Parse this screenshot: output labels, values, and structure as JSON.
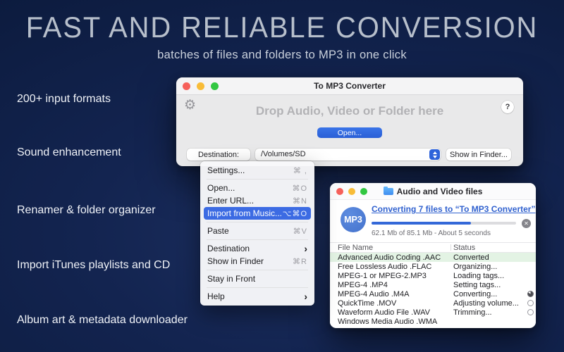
{
  "page": {
    "title": "FAST AND RELIABLE CONVERSION",
    "subtitle": "batches of files and folders to MP3 in one click"
  },
  "features": [
    {
      "label": "200+ input formats"
    },
    {
      "label": "Sound enhancement"
    },
    {
      "label": "Renamer & folder organizer"
    },
    {
      "label": "Import iTunes playlists and CD"
    },
    {
      "label": "Album art & metadata downloader"
    }
  ],
  "main_window": {
    "title": "To MP3 Converter",
    "drop_hint": "Drop Audio, Video or Folder here",
    "open_button": "Open...",
    "destination_button": "Destination:",
    "destination_path": "/Volumes/SD",
    "show_in_finder_button": "Show in Finder...",
    "help_button": "?",
    "gear_icon": "⚙"
  },
  "menu": {
    "items": [
      {
        "label": "Settings...",
        "shortcut": "⌘ ,"
      },
      {
        "label": "Open...",
        "shortcut": "⌘O"
      },
      {
        "label": "Enter URL...",
        "shortcut": "⌘N"
      },
      {
        "label": "Import from Music...",
        "shortcut": "⌥⌘O",
        "highlighted": true
      },
      {
        "label": "Paste",
        "shortcut": "⌘V"
      },
      {
        "label": "Destination",
        "submenu": "›"
      },
      {
        "label": "Show in Finder",
        "shortcut": "⌘R"
      },
      {
        "label": "Stay in Front",
        "shortcut": ""
      },
      {
        "label": "Help",
        "submenu": "›"
      }
    ]
  },
  "progress_window": {
    "title": "Audio and Video files",
    "badge": "MP3",
    "task_link": "Converting 7 files to “To MP3 Converter”",
    "progress_percent": 69,
    "progress_text": "62.1 Mb of 85.1 Mb - About 5 seconds",
    "cancel_icon": "✕",
    "table": {
      "columns": [
        "File Name",
        "Status"
      ],
      "rows": [
        {
          "file": "Advanced Audio Coding .AAC",
          "status": "Converted",
          "state": "converted",
          "indicator": ""
        },
        {
          "file": "Free Lossless Audio .FLAC",
          "status": "Organizing...",
          "state": "",
          "indicator": ""
        },
        {
          "file": "MPEG-1 or MPEG-2.MP3",
          "status": "Loading tags...",
          "state": "",
          "indicator": ""
        },
        {
          "file": "MPEG-4 .MP4",
          "status": "Setting tags...",
          "state": "",
          "indicator": ""
        },
        {
          "file": "MPEG-4 Audio .M4A",
          "status": "Converting...",
          "state": "",
          "indicator": "pie-progress"
        },
        {
          "file": "QuickTime .MOV",
          "status": "Adjusting volume...",
          "state": "",
          "indicator": "empty-circle"
        },
        {
          "file": "Waveform Audio File .WAV",
          "status": "Trimming...",
          "state": "",
          "indicator": "empty-circle"
        },
        {
          "file": "Windows Media Audio .WMA",
          "status": "",
          "state": "",
          "indicator": ""
        }
      ]
    }
  },
  "colors": {
    "background_navy": "#12234d",
    "hero_text": "#b7bfcb",
    "accent_blue": "#2e63da",
    "menu_highlight": "#3c6be3",
    "link_blue": "#3061cf",
    "progress_blue": "#3468d8",
    "converted_row_green": "#e3f3e4",
    "traffic_red": "#f6605a",
    "traffic_yellow": "#f8bc38",
    "traffic_green": "#32c741"
  }
}
